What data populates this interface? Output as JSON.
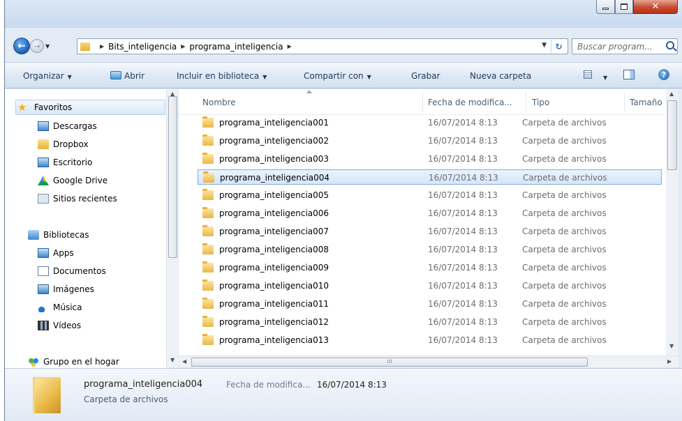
{
  "address": {
    "crumbs": [
      "Bits_inteligencia",
      "programa_inteligencia"
    ],
    "search_placeholder": "Buscar program..."
  },
  "toolbar": {
    "organize": "Organizar",
    "open": "Abrir",
    "include": "Incluir en biblioteca",
    "share": "Compartir con",
    "burn": "Grabar",
    "new_folder": "Nueva carpeta"
  },
  "nav": {
    "favorites": "Favoritos",
    "downloads": "Descargas",
    "dropbox": "Dropbox",
    "desktop": "Escritorio",
    "gdrive": "Google Drive",
    "recent": "Sitios recientes",
    "libraries": "Bibliotecas",
    "apps": "Apps",
    "documents": "Documentos",
    "images": "Imágenes",
    "music": "Música",
    "videos": "Vídeos",
    "homegroup": "Grupo en el hogar"
  },
  "columns": {
    "name": "Nombre",
    "date": "Fecha de modifica...",
    "type": "Tipo",
    "size": "Tamaño"
  },
  "files": [
    {
      "name": "programa_inteligencia001",
      "date": "16/07/2014 8:13",
      "type": "Carpeta de archivos"
    },
    {
      "name": "programa_inteligencia002",
      "date": "16/07/2014 8:13",
      "type": "Carpeta de archivos"
    },
    {
      "name": "programa_inteligencia003",
      "date": "16/07/2014 8:13",
      "type": "Carpeta de archivos"
    },
    {
      "name": "programa_inteligencia004",
      "date": "16/07/2014 8:13",
      "type": "Carpeta de archivos"
    },
    {
      "name": "programa_inteligencia005",
      "date": "16/07/2014 8:13",
      "type": "Carpeta de archivos"
    },
    {
      "name": "programa_inteligencia006",
      "date": "16/07/2014 8:13",
      "type": "Carpeta de archivos"
    },
    {
      "name": "programa_inteligencia007",
      "date": "16/07/2014 8:13",
      "type": "Carpeta de archivos"
    },
    {
      "name": "programa_inteligencia008",
      "date": "16/07/2014 8:13",
      "type": "Carpeta de archivos"
    },
    {
      "name": "programa_inteligencia009",
      "date": "16/07/2014 8:13",
      "type": "Carpeta de archivos"
    },
    {
      "name": "programa_inteligencia010",
      "date": "16/07/2014 8:13",
      "type": "Carpeta de archivos"
    },
    {
      "name": "programa_inteligencia011",
      "date": "16/07/2014 8:13",
      "type": "Carpeta de archivos"
    },
    {
      "name": "programa_inteligencia012",
      "date": "16/07/2014 8:13",
      "type": "Carpeta de archivos"
    },
    {
      "name": "programa_inteligencia013",
      "date": "16/07/2014 8:13",
      "type": "Carpeta de archivos"
    }
  ],
  "selected_index": 3,
  "details": {
    "name": "programa_inteligencia004",
    "date_label": "Fecha de modifica...",
    "date": "16/07/2014 8:13",
    "type": "Carpeta de archivos"
  }
}
